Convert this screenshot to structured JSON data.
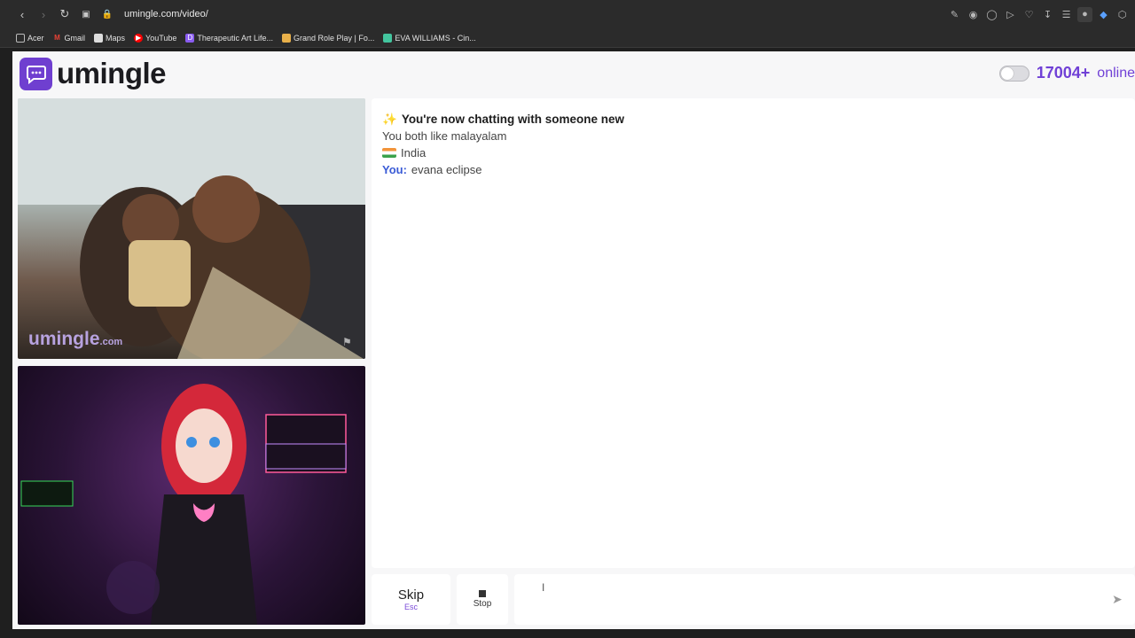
{
  "browser": {
    "url": "umingle.com/video/",
    "bookmarks": [
      {
        "label": "Acer",
        "icon": "folder-icon",
        "color": "#cccccc"
      },
      {
        "label": "Gmail",
        "icon": "gmail-icon",
        "color": "#e94235"
      },
      {
        "label": "Maps",
        "icon": "maps-icon",
        "color": "#cccccc"
      },
      {
        "label": "YouTube",
        "icon": "youtube-icon",
        "color": "#ff0000"
      },
      {
        "label": "Therapeutic Art Life...",
        "icon": "art-icon",
        "color": "#8a5cf0"
      },
      {
        "label": "Grand Role Play | Fo...",
        "icon": "game-icon",
        "color": "#e8b04a"
      },
      {
        "label": "EVA WILLIAMS - Cin...",
        "icon": "cinema-icon",
        "color": "#43c59e"
      }
    ]
  },
  "header": {
    "logo_text": "umingle",
    "online_count": "17004+",
    "online_label": "online"
  },
  "videos": {
    "remote_watermark": "umingle",
    "remote_watermark_suffix": ".com"
  },
  "chat": {
    "intro": "You're now chatting with someone new",
    "intro_icon": "sparkles-icon",
    "common_interest": "You both like malayalam",
    "country": "India",
    "you_label": "You:",
    "you_message": "evana eclipse"
  },
  "controls": {
    "skip_label": "Skip",
    "skip_hint": "Esc",
    "stop_label": "Stop",
    "message_placeholder": ""
  },
  "colors": {
    "brand": "#6f3fd0",
    "accent": "#7040d6",
    "you": "#3a5bd6"
  }
}
